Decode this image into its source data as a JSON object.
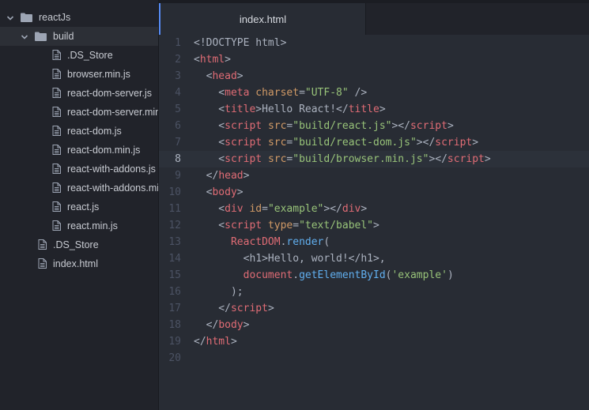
{
  "colors": {
    "tag": "#e06c75",
    "attribute": "#d19a66",
    "string": "#98c379",
    "function": "#61afef",
    "plain": "#abb2bf",
    "tab_accent": "#568af2"
  },
  "sidebar": {
    "items": [
      {
        "label": "reactJs",
        "kind": "folder",
        "expanded": true,
        "depth": 0,
        "icon": "folder-icon"
      },
      {
        "label": "build",
        "kind": "folder",
        "expanded": true,
        "depth": 1,
        "icon": "folder-icon",
        "selected": true
      },
      {
        "label": ".DS_Store",
        "kind": "file",
        "depth": 2,
        "icon": "file-icon"
      },
      {
        "label": "browser.min.js",
        "kind": "file",
        "depth": 2,
        "icon": "file-icon"
      },
      {
        "label": "react-dom-server.js",
        "kind": "file",
        "depth": 2,
        "icon": "file-icon"
      },
      {
        "label": "react-dom-server.min.js",
        "kind": "file",
        "depth": 2,
        "icon": "file-icon"
      },
      {
        "label": "react-dom.js",
        "kind": "file",
        "depth": 2,
        "icon": "file-icon"
      },
      {
        "label": "react-dom.min.js",
        "kind": "file",
        "depth": 2,
        "icon": "file-icon"
      },
      {
        "label": "react-with-addons.js",
        "kind": "file",
        "depth": 2,
        "icon": "file-icon"
      },
      {
        "label": "react-with-addons.min.js",
        "kind": "file",
        "depth": 2,
        "icon": "file-icon"
      },
      {
        "label": "react.js",
        "kind": "file",
        "depth": 2,
        "icon": "file-icon"
      },
      {
        "label": "react.min.js",
        "kind": "file",
        "depth": 2,
        "icon": "file-icon"
      },
      {
        "label": ".DS_Store",
        "kind": "file",
        "depth": 1,
        "icon": "file-icon"
      },
      {
        "label": "index.html",
        "kind": "file",
        "depth": 1,
        "icon": "file-icon"
      }
    ]
  },
  "tabs": [
    {
      "label": "index.html",
      "active": true
    }
  ],
  "editor": {
    "active_line": 8,
    "lines": [
      {
        "n": "1",
        "tokens": [
          {
            "t": "<!DOCTYPE html>",
            "c": "plain"
          }
        ]
      },
      {
        "n": "2",
        "tokens": [
          {
            "t": "<",
            "c": "plain"
          },
          {
            "t": "html",
            "c": "tag"
          },
          {
            "t": ">",
            "c": "plain"
          }
        ]
      },
      {
        "n": "3",
        "tokens": [
          {
            "t": "  <",
            "c": "plain"
          },
          {
            "t": "head",
            "c": "tag"
          },
          {
            "t": ">",
            "c": "plain"
          }
        ]
      },
      {
        "n": "4",
        "tokens": [
          {
            "t": "    <",
            "c": "plain"
          },
          {
            "t": "meta",
            "c": "tag"
          },
          {
            "t": " ",
            "c": "plain"
          },
          {
            "t": "charset",
            "c": "attr"
          },
          {
            "t": "=",
            "c": "plain"
          },
          {
            "t": "\"UTF-8\"",
            "c": "str"
          },
          {
            "t": " />",
            "c": "plain"
          }
        ]
      },
      {
        "n": "5",
        "tokens": [
          {
            "t": "    <",
            "c": "plain"
          },
          {
            "t": "title",
            "c": "tag"
          },
          {
            "t": ">Hello React!</",
            "c": "plain"
          },
          {
            "t": "title",
            "c": "tag"
          },
          {
            "t": ">",
            "c": "plain"
          }
        ]
      },
      {
        "n": "6",
        "tokens": [
          {
            "t": "    <",
            "c": "plain"
          },
          {
            "t": "script",
            "c": "tag"
          },
          {
            "t": " ",
            "c": "plain"
          },
          {
            "t": "src",
            "c": "attr"
          },
          {
            "t": "=",
            "c": "plain"
          },
          {
            "t": "\"build/react.js\"",
            "c": "str"
          },
          {
            "t": "></",
            "c": "plain"
          },
          {
            "t": "script",
            "c": "tag"
          },
          {
            "t": ">",
            "c": "plain"
          }
        ]
      },
      {
        "n": "7",
        "tokens": [
          {
            "t": "    <",
            "c": "plain"
          },
          {
            "t": "script",
            "c": "tag"
          },
          {
            "t": " ",
            "c": "plain"
          },
          {
            "t": "src",
            "c": "attr"
          },
          {
            "t": "=",
            "c": "plain"
          },
          {
            "t": "\"build/react-dom.js\"",
            "c": "str"
          },
          {
            "t": "></",
            "c": "plain"
          },
          {
            "t": "script",
            "c": "tag"
          },
          {
            "t": ">",
            "c": "plain"
          }
        ]
      },
      {
        "n": "8",
        "tokens": [
          {
            "t": "    <",
            "c": "plain"
          },
          {
            "t": "script",
            "c": "tag"
          },
          {
            "t": " ",
            "c": "plain"
          },
          {
            "t": "src",
            "c": "attr"
          },
          {
            "t": "=",
            "c": "plain"
          },
          {
            "t": "\"build/browser.min.js\"",
            "c": "str"
          },
          {
            "t": "></",
            "c": "plain"
          },
          {
            "t": "script",
            "c": "tag"
          },
          {
            "t": ">",
            "c": "plain"
          }
        ]
      },
      {
        "n": "9",
        "tokens": [
          {
            "t": "  </",
            "c": "plain"
          },
          {
            "t": "head",
            "c": "tag"
          },
          {
            "t": ">",
            "c": "plain"
          }
        ]
      },
      {
        "n": "10",
        "tokens": [
          {
            "t": "  <",
            "c": "plain"
          },
          {
            "t": "body",
            "c": "tag"
          },
          {
            "t": ">",
            "c": "plain"
          }
        ]
      },
      {
        "n": "11",
        "tokens": [
          {
            "t": "    <",
            "c": "plain"
          },
          {
            "t": "div",
            "c": "tag"
          },
          {
            "t": " ",
            "c": "plain"
          },
          {
            "t": "id",
            "c": "attr"
          },
          {
            "t": "=",
            "c": "plain"
          },
          {
            "t": "\"example\"",
            "c": "str"
          },
          {
            "t": "></",
            "c": "plain"
          },
          {
            "t": "div",
            "c": "tag"
          },
          {
            "t": ">",
            "c": "plain"
          }
        ]
      },
      {
        "n": "12",
        "tokens": [
          {
            "t": "    <",
            "c": "plain"
          },
          {
            "t": "script",
            "c": "tag"
          },
          {
            "t": " ",
            "c": "plain"
          },
          {
            "t": "type",
            "c": "attr"
          },
          {
            "t": "=",
            "c": "plain"
          },
          {
            "t": "\"text/babel\"",
            "c": "str"
          },
          {
            "t": ">",
            "c": "plain"
          }
        ]
      },
      {
        "n": "13",
        "tokens": [
          {
            "t": "      ",
            "c": "plain"
          },
          {
            "t": "ReactDOM",
            "c": "obj"
          },
          {
            "t": ".",
            "c": "plain"
          },
          {
            "t": "render",
            "c": "fn"
          },
          {
            "t": "(",
            "c": "plain"
          }
        ]
      },
      {
        "n": "14",
        "tokens": [
          {
            "t": "        <h1>Hello, world!</h1>,",
            "c": "plain"
          }
        ]
      },
      {
        "n": "15",
        "tokens": [
          {
            "t": "        ",
            "c": "plain"
          },
          {
            "t": "document",
            "c": "obj"
          },
          {
            "t": ".",
            "c": "plain"
          },
          {
            "t": "getElementById",
            "c": "fn"
          },
          {
            "t": "(",
            "c": "plain"
          },
          {
            "t": "'example'",
            "c": "str"
          },
          {
            "t": ")",
            "c": "plain"
          }
        ]
      },
      {
        "n": "16",
        "tokens": [
          {
            "t": "      );",
            "c": "plain"
          }
        ]
      },
      {
        "n": "17",
        "tokens": [
          {
            "t": "    </",
            "c": "plain"
          },
          {
            "t": "script",
            "c": "tag"
          },
          {
            "t": ">",
            "c": "plain"
          }
        ]
      },
      {
        "n": "18",
        "tokens": [
          {
            "t": "  </",
            "c": "plain"
          },
          {
            "t": "body",
            "c": "tag"
          },
          {
            "t": ">",
            "c": "plain"
          }
        ]
      },
      {
        "n": "19",
        "tokens": [
          {
            "t": "</",
            "c": "plain"
          },
          {
            "t": "html",
            "c": "tag"
          },
          {
            "t": ">",
            "c": "plain"
          }
        ]
      },
      {
        "n": "20",
        "tokens": []
      }
    ]
  }
}
